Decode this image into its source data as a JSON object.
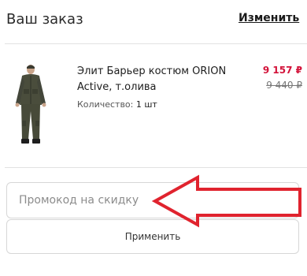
{
  "order": {
    "title": "Ваш заказ",
    "change_link": "Изменить"
  },
  "product": {
    "name": "Элит Барьер костюм ORION Active, т.олива",
    "quantity_label": "Количество:",
    "quantity_value": "1 шт",
    "price_current": "9 157 ₽",
    "price_old": "9 440 ₽",
    "image_icon": "jacket-pants-suit-photo"
  },
  "promo": {
    "placeholder": "Промокод на скидку",
    "value": "",
    "apply_label": "Применить"
  },
  "annotation": {
    "arrow_color": "#e0232e",
    "arrow_icon": "left-arrow-annotation"
  }
}
